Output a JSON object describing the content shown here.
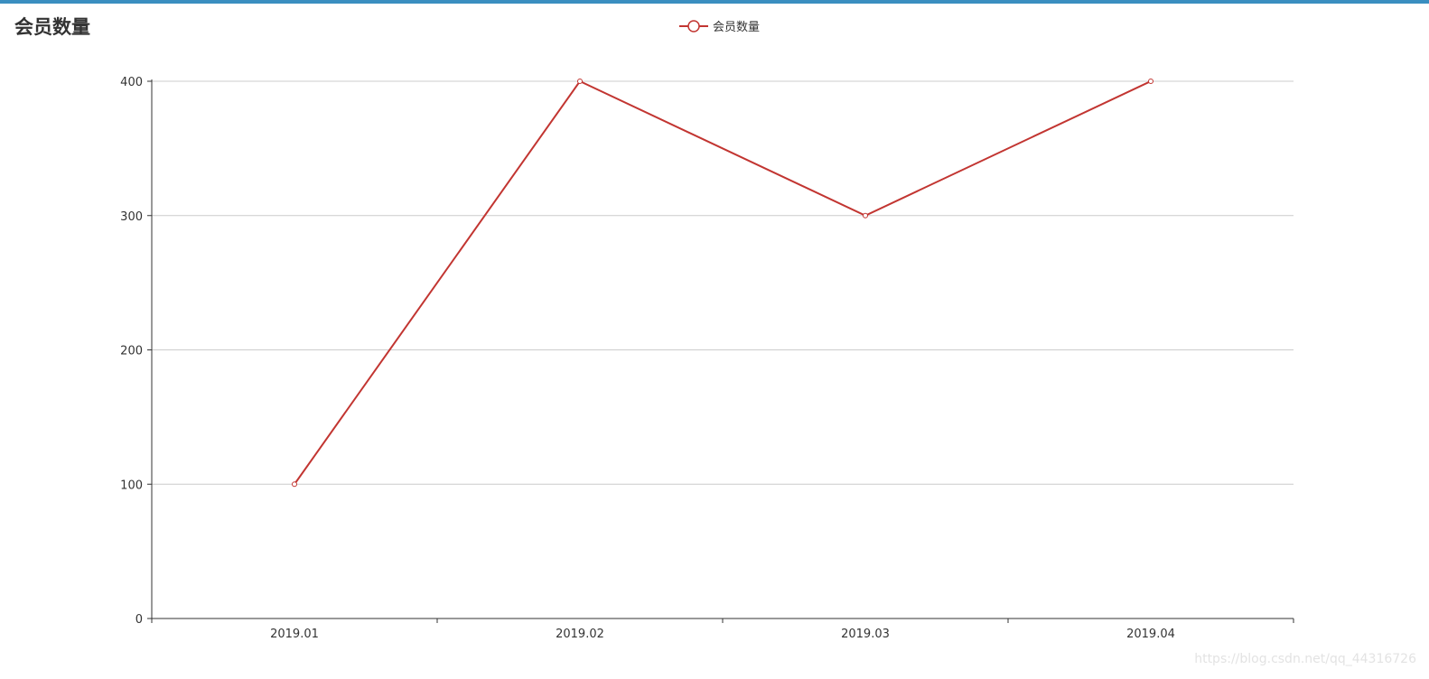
{
  "colors": {
    "top_bar": "#3a8ec0",
    "series_line": "#c23531",
    "axis": "#333333",
    "grid": "#cccccc",
    "label": "#333333"
  },
  "watermark": "https://blog.csdn.net/qq_44316726",
  "chart_data": {
    "type": "line",
    "title": "会员数量",
    "categories": [
      "2019.01",
      "2019.02",
      "2019.03",
      "2019.04"
    ],
    "series": [
      {
        "name": "会员数量",
        "values": [
          100,
          400,
          300,
          400
        ]
      }
    ],
    "ylim": [
      0,
      400
    ],
    "yticks": [
      0,
      100,
      200,
      300,
      400
    ],
    "grid": true,
    "legend": "top-center",
    "marker": "empty-circle"
  }
}
